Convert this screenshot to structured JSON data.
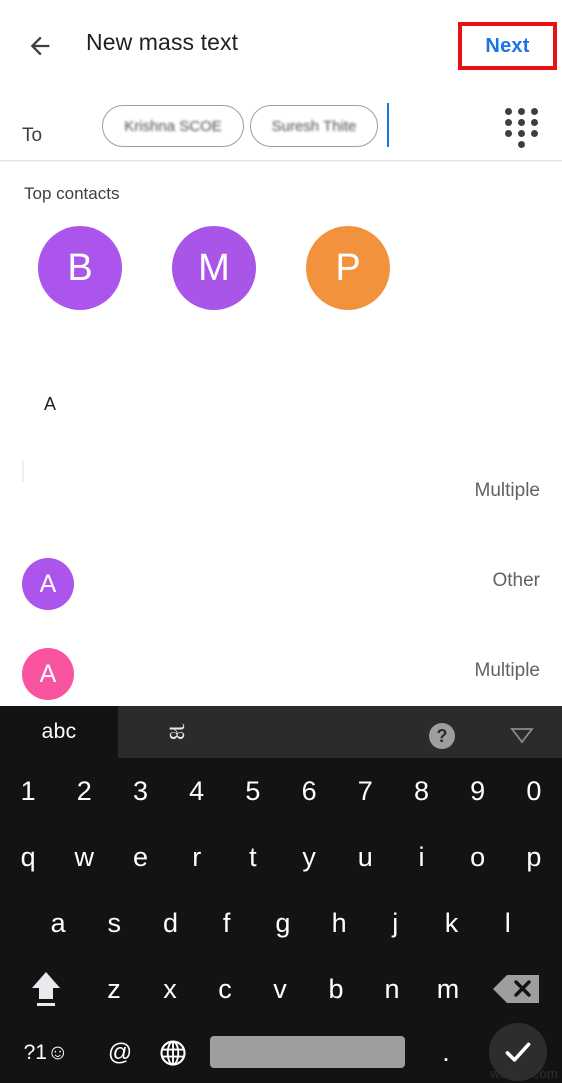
{
  "appbar": {
    "back_icon": "arrow-back-icon",
    "title": "New mass text",
    "next_label": "Next",
    "next_color": "#1a73e8",
    "highlight_color": "#e8120e"
  },
  "recipients": {
    "to_label": "To",
    "chips": [
      {
        "name": "Krishna SCOE"
      },
      {
        "name": "Suresh Thite"
      }
    ],
    "dialpad_icon": "dialpad-icon"
  },
  "contacts": {
    "section_title": "Top contacts",
    "top_contacts": [
      {
        "initial": "B",
        "color": "#ab55ec"
      },
      {
        "initial": "M",
        "color": "#a855e8"
      },
      {
        "initial": "P",
        "color": "#f3923d"
      }
    ],
    "alpha_header": "A",
    "rows": [
      {
        "initial": "",
        "color": "#ffffff",
        "name": "",
        "meta": "Multiple"
      },
      {
        "initial": "A",
        "color": "#ab55ec",
        "name": "",
        "meta": "Other"
      },
      {
        "initial": "A",
        "color": "#f9549f",
        "name": "",
        "meta": "Multiple"
      }
    ]
  },
  "keyboard": {
    "tabs": [
      {
        "label": "abc",
        "active": true
      },
      {
        "label": "ಹ",
        "active": false
      }
    ],
    "help_icon": "help-icon",
    "help_label": "?",
    "collapse_icon": "collapse-keyboard-icon",
    "rows": {
      "numbers": [
        "1",
        "2",
        "3",
        "4",
        "5",
        "6",
        "7",
        "8",
        "9",
        "0"
      ],
      "top": [
        "q",
        "w",
        "e",
        "r",
        "t",
        "y",
        "u",
        "i",
        "o",
        "p"
      ],
      "home": [
        "a",
        "s",
        "d",
        "f",
        "g",
        "h",
        "j",
        "k",
        "l"
      ],
      "bottom": [
        "z",
        "x",
        "c",
        "v",
        "b",
        "n",
        "m"
      ]
    },
    "shift_icon": "shift-caps-icon",
    "backspace_icon": "backspace-icon",
    "symbols_label": "?1☺",
    "at_label": "@",
    "globe_icon": "language-globe-icon",
    "space_label": "",
    "period_label": ".",
    "enter_icon": "check-icon"
  },
  "watermark": {
    "text": "wsxdn.com"
  }
}
